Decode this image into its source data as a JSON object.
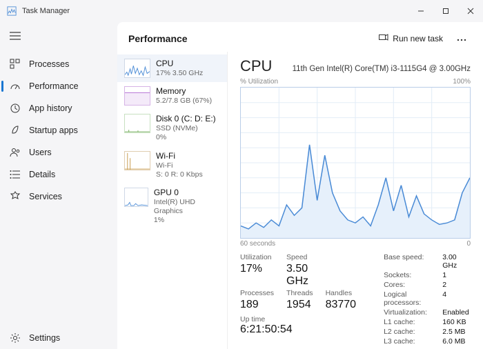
{
  "app": {
    "title": "Task Manager"
  },
  "nav": {
    "items": [
      {
        "label": "Processes"
      },
      {
        "label": "Performance"
      },
      {
        "label": "App history"
      },
      {
        "label": "Startup apps"
      },
      {
        "label": "Users"
      },
      {
        "label": "Details"
      },
      {
        "label": "Services"
      }
    ],
    "settings": "Settings"
  },
  "header": {
    "title": "Performance",
    "run_task": "Run new task"
  },
  "perf": {
    "items": [
      {
        "name": "CPU",
        "sub": "17%  3.50 GHz"
      },
      {
        "name": "Memory",
        "sub": "5.2/7.8 GB (67%)"
      },
      {
        "name": "Disk 0 (C: D: E:)",
        "sub1": "SSD (NVMe)",
        "sub2": "0%"
      },
      {
        "name": "Wi-Fi",
        "sub1": "Wi-Fi",
        "sub2": "S: 0 R: 0 Kbps"
      },
      {
        "name": "GPU 0",
        "sub1": "Intel(R) UHD Graphics",
        "sub2": "1%"
      }
    ]
  },
  "detail": {
    "title": "CPU",
    "model": "11th Gen Intel(R) Core(TM) i3-1115G4 @ 3.00GHz",
    "ylabel": "% Utilization",
    "ymax": "100%",
    "xleft": "60 seconds",
    "xright": "0",
    "stats": {
      "util_lbl": "Utilization",
      "util_val": "17%",
      "speed_lbl": "Speed",
      "speed_val": "3.50 GHz",
      "proc_lbl": "Processes",
      "proc_val": "189",
      "thr_lbl": "Threads",
      "thr_val": "1954",
      "hnd_lbl": "Handles",
      "hnd_val": "83770",
      "upt_lbl": "Up time",
      "upt_val": "6:21:50:54"
    },
    "kv": [
      {
        "k": "Base speed:",
        "v": "3.00 GHz"
      },
      {
        "k": "Sockets:",
        "v": "1"
      },
      {
        "k": "Cores:",
        "v": "2"
      },
      {
        "k": "Logical processors:",
        "v": "4"
      },
      {
        "k": "Virtualization:",
        "v": "Enabled"
      },
      {
        "k": "L1 cache:",
        "v": "160 KB"
      },
      {
        "k": "L2 cache:",
        "v": "2.5 MB"
      },
      {
        "k": "L3 cache:",
        "v": "6.0 MB"
      }
    ]
  },
  "chart_data": {
    "type": "line",
    "title": "CPU % Utilization",
    "xlabel": "seconds ago",
    "ylabel": "% Utilization",
    "ylim": [
      0,
      100
    ],
    "x": [
      60,
      58,
      56,
      54,
      52,
      50,
      48,
      46,
      44,
      42,
      40,
      38,
      36,
      34,
      32,
      30,
      28,
      26,
      24,
      22,
      20,
      18,
      16,
      14,
      12,
      10,
      8,
      6,
      4,
      2,
      0
    ],
    "values": [
      8,
      6,
      10,
      7,
      12,
      8,
      22,
      15,
      20,
      62,
      25,
      55,
      30,
      18,
      12,
      10,
      14,
      8,
      22,
      40,
      18,
      35,
      14,
      28,
      16,
      12,
      9,
      10,
      12,
      30,
      40
    ]
  }
}
